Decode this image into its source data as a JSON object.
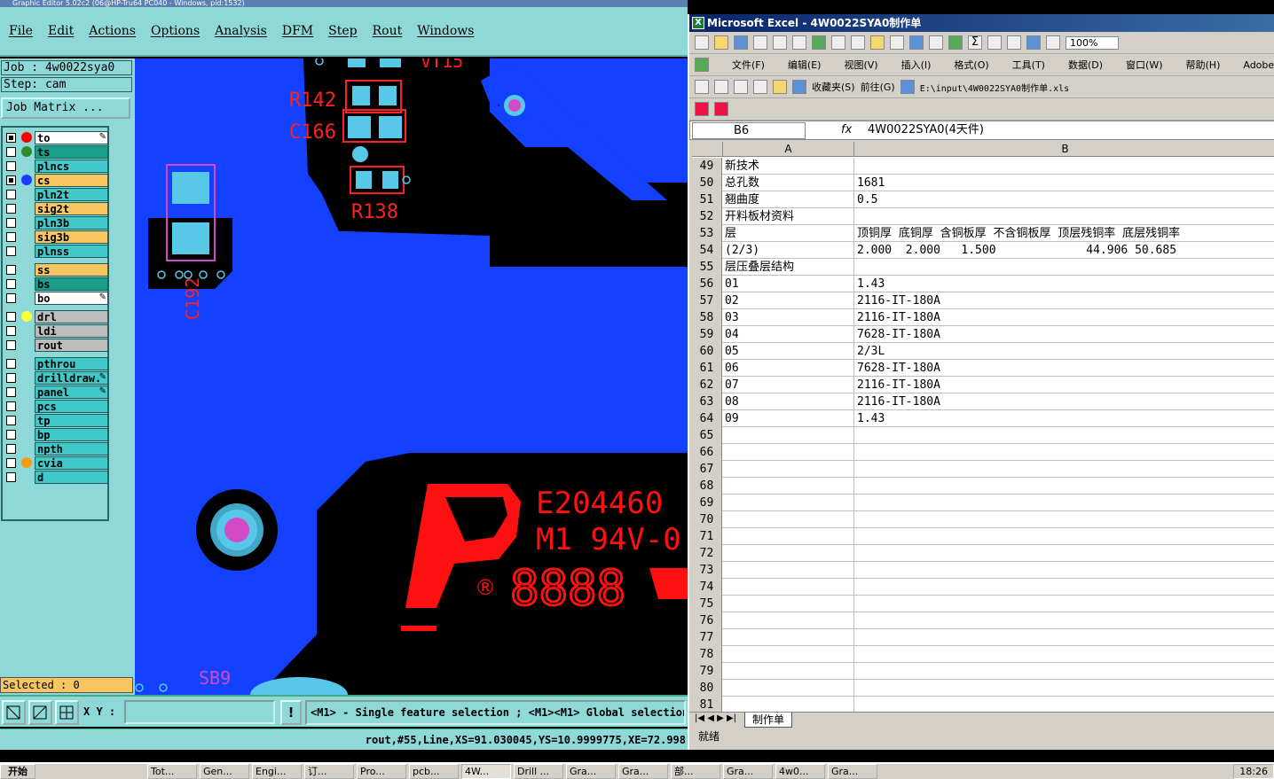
{
  "editor": {
    "title": "Graphic Editor 5.02c2 (06@HP-Tru64 PC040 - Windows, pid:1532)",
    "menu": [
      "File",
      "Edit",
      "Actions",
      "Options",
      "Analysis",
      "DFM",
      "Step",
      "Rout",
      "Windows"
    ],
    "job_line": "Job : 4w0022sya0",
    "step_line": "Step: cam",
    "job_matrix_button": "Job Matrix ...",
    "layers": [
      {
        "name": "to",
        "color": "#ffffff",
        "dot": "#ff0000",
        "checked": true,
        "edit": true
      },
      {
        "name": "ts",
        "color": "#1aa08a",
        "dot": "#2e8b2e",
        "checked": false,
        "edit": false
      },
      {
        "name": "plncs",
        "color": "#41c8c8",
        "dot": "",
        "checked": false,
        "edit": false
      },
      {
        "name": "cs",
        "color": "#f7c660",
        "dot": "#1a3cff",
        "checked": true,
        "edit": false
      },
      {
        "name": "pln2t",
        "color": "#41c8c8",
        "dot": "",
        "checked": false,
        "edit": false
      },
      {
        "name": "sig2t",
        "color": "#f7c660",
        "dot": "",
        "checked": false,
        "edit": false
      },
      {
        "name": "pln3b",
        "color": "#41c8c8",
        "dot": "",
        "checked": false,
        "edit": false
      },
      {
        "name": "sig3b",
        "color": "#f7c660",
        "dot": "",
        "checked": false,
        "edit": false
      },
      {
        "name": "plnss",
        "color": "#41c8c8",
        "dot": "",
        "checked": false,
        "edit": false
      },
      {
        "name": "ss",
        "color": "#f7c660",
        "dot": "",
        "checked": false,
        "edit": false
      },
      {
        "name": "bs",
        "color": "#1aa08a",
        "dot": "",
        "checked": false,
        "edit": false
      },
      {
        "name": "bo",
        "color": "#ffffff",
        "dot": "",
        "checked": false,
        "edit": true
      },
      {
        "name": "drl",
        "color": "#bdbdbd",
        "dot": "#ffff33",
        "checked": false,
        "edit": false
      },
      {
        "name": "ldi",
        "color": "#bdbdbd",
        "dot": "",
        "checked": false,
        "edit": false
      },
      {
        "name": "rout",
        "color": "#bdbdbd",
        "dot": "",
        "checked": false,
        "edit": false
      },
      {
        "name": "pthrou",
        "color": "#41c8c8",
        "dot": "",
        "checked": false,
        "edit": false
      },
      {
        "name": "drilldraw.",
        "color": "#41c8c8",
        "dot": "",
        "checked": false,
        "edit": true
      },
      {
        "name": "panel",
        "color": "#41c8c8",
        "dot": "",
        "checked": false,
        "edit": true
      },
      {
        "name": "pcs",
        "color": "#41c8c8",
        "dot": "",
        "checked": false,
        "edit": false
      },
      {
        "name": "tp",
        "color": "#41c8c8",
        "dot": "",
        "checked": false,
        "edit": false
      },
      {
        "name": "bp",
        "color": "#41c8c8",
        "dot": "",
        "checked": false,
        "edit": false
      },
      {
        "name": "npth",
        "color": "#41c8c8",
        "dot": "",
        "checked": false,
        "edit": false
      },
      {
        "name": "cvia",
        "color": "#41c8c8",
        "dot": "#f39c12",
        "checked": false,
        "edit": false
      },
      {
        "name": "d",
        "color": "#41c8c8",
        "dot": "",
        "checked": false,
        "edit": false
      }
    ],
    "selected_text": "Selected : 0",
    "xy_label": "X Y :",
    "xy_value": "",
    "warn_label": "!",
    "hint": "<M1> - Single feature selection ; <M1><M1> Global selection",
    "status": "rout,#55,Line,XS=91.030045,YS=10.9999775,XE=72.998",
    "canvas_labels": {
      "vt": "VT15",
      "r142": "R142",
      "c166": "C166",
      "r138": "R138",
      "c192": "C192",
      "sb9": "SB9",
      "ul_number": "E204460",
      "ul_rating": "M1 94V-0",
      "date_code": "8888",
      "registered": "®"
    }
  },
  "excel": {
    "title": "Microsoft Excel - 4W0022SYA0制作单",
    "menus": [
      "文件(F)",
      "编辑(E)",
      "视图(V)",
      "插入(I)",
      "格式(O)",
      "工具(T)",
      "数据(D)",
      "窗口(W)",
      "帮助(H)",
      "Adobe PDF(B)"
    ],
    "zoom": "100%",
    "web_bar": {
      "favorites": "收藏夹(S)",
      "goto": "前往(G)",
      "path": "E:\\input\\4W0022SYA0制作单.xls"
    },
    "name_box": "B6",
    "formula": "4W0022SYA0(4天件)",
    "columns": [
      "A",
      "B"
    ],
    "rows": [
      {
        "n": "49",
        "a": "新技术",
        "b": ""
      },
      {
        "n": "50",
        "a": "总孔数",
        "b": "1681"
      },
      {
        "n": "51",
        "a": "翘曲度",
        "b": "0.5"
      },
      {
        "n": "52",
        "a": "开料板材资料",
        "b": ""
      },
      {
        "n": "53",
        "a": "层",
        "b": "顶铜厚 底铜厚 含铜板厚 不含铜板厚 顶层残铜率 底层残铜率"
      },
      {
        "n": "54",
        "a": "(2/3)",
        "b": "2.000  2.000   1.500             44.906 50.685"
      },
      {
        "n": "55",
        "a": "层压叠层结构",
        "b": ""
      },
      {
        "n": "56",
        "a": "01",
        "b": "1.43"
      },
      {
        "n": "57",
        "a": "02",
        "b": "2116-IT-180A"
      },
      {
        "n": "58",
        "a": "03",
        "b": "2116-IT-180A"
      },
      {
        "n": "59",
        "a": "04",
        "b": "7628-IT-180A"
      },
      {
        "n": "60",
        "a": "05",
        "b": "2/3L"
      },
      {
        "n": "61",
        "a": "06",
        "b": "7628-IT-180A"
      },
      {
        "n": "62",
        "a": "07",
        "b": "2116-IT-180A"
      },
      {
        "n": "63",
        "a": "08",
        "b": "2116-IT-180A"
      },
      {
        "n": "64",
        "a": "09",
        "b": "1.43"
      },
      {
        "n": "65",
        "a": "",
        "b": ""
      },
      {
        "n": "66",
        "a": "",
        "b": ""
      },
      {
        "n": "67",
        "a": "",
        "b": ""
      },
      {
        "n": "68",
        "a": "",
        "b": ""
      },
      {
        "n": "69",
        "a": "",
        "b": ""
      },
      {
        "n": "70",
        "a": "",
        "b": ""
      },
      {
        "n": "71",
        "a": "",
        "b": ""
      },
      {
        "n": "72",
        "a": "",
        "b": ""
      },
      {
        "n": "73",
        "a": "",
        "b": ""
      },
      {
        "n": "74",
        "a": "",
        "b": ""
      },
      {
        "n": "75",
        "a": "",
        "b": ""
      },
      {
        "n": "76",
        "a": "",
        "b": ""
      },
      {
        "n": "77",
        "a": "",
        "b": ""
      },
      {
        "n": "78",
        "a": "",
        "b": ""
      },
      {
        "n": "79",
        "a": "",
        "b": ""
      },
      {
        "n": "80",
        "a": "",
        "b": ""
      },
      {
        "n": "81",
        "a": "",
        "b": ""
      }
    ],
    "sheet_tab": "制作单",
    "status": "就绪"
  },
  "taskbar": {
    "start": "开始",
    "items": [
      "Tot...",
      "Gen...",
      "Engi...",
      "订...",
      "Pro...",
      "pcb...",
      "4W...",
      "Drill ...",
      "Gra...",
      "Gra...",
      "部...",
      "Gra...",
      "4w0...",
      "Gra..."
    ],
    "active_index": 6,
    "clock": "18:26"
  }
}
